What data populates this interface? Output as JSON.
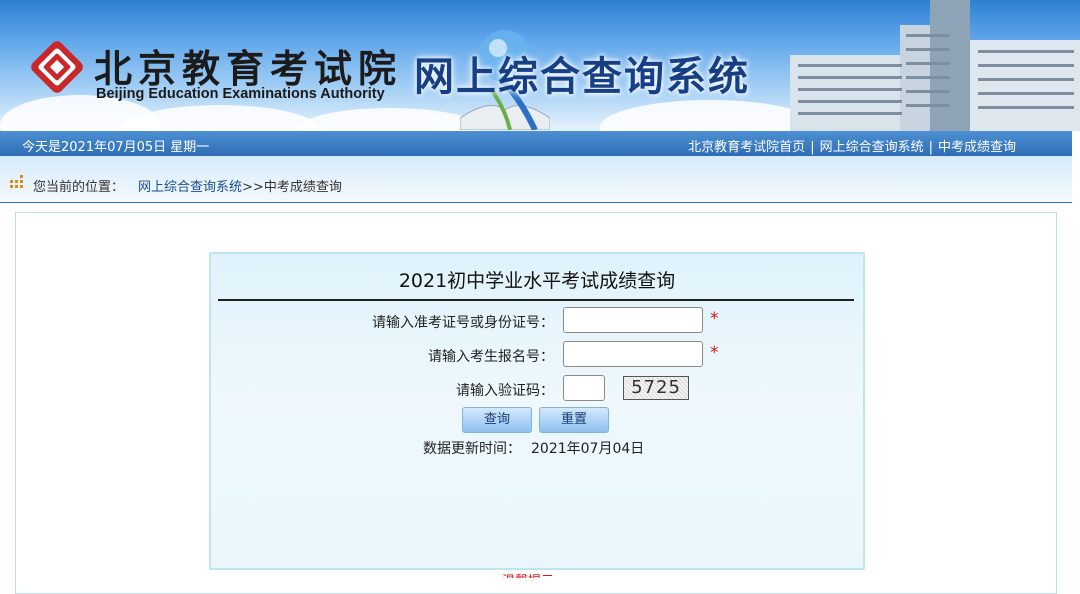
{
  "header": {
    "logo_cn": "北京教育考试院",
    "logo_en": "Beijing Education Examinations Authority",
    "system_title": "网上综合查询系统",
    "brand_color": "#c8282a"
  },
  "topbar": {
    "date_text": "今天是2021年07月05日 星期一",
    "links": [
      "北京教育考试院首页",
      "网上综合查询系统",
      "中考成绩查询"
    ],
    "separator": "|"
  },
  "breadcrumb": {
    "prefix": "您当前的位置：",
    "link": "网上综合查询系统",
    "current": ">>中考成绩查询"
  },
  "form": {
    "title": "2021初中学业水平考试成绩查询",
    "fields": [
      {
        "label": "请输入准考证号或身份证号：",
        "value": "",
        "required": true
      },
      {
        "label": "请输入考生报名号：",
        "value": "",
        "required": true
      },
      {
        "label": "请输入验证码：",
        "value": "",
        "required": false
      }
    ],
    "required_mark": "*",
    "captcha_text": "5725",
    "query_button": "查询",
    "reset_button": "重置",
    "update_label": "数据更新时间：",
    "update_value": "2021年07月04日"
  },
  "footer_peek": "温馨提示"
}
